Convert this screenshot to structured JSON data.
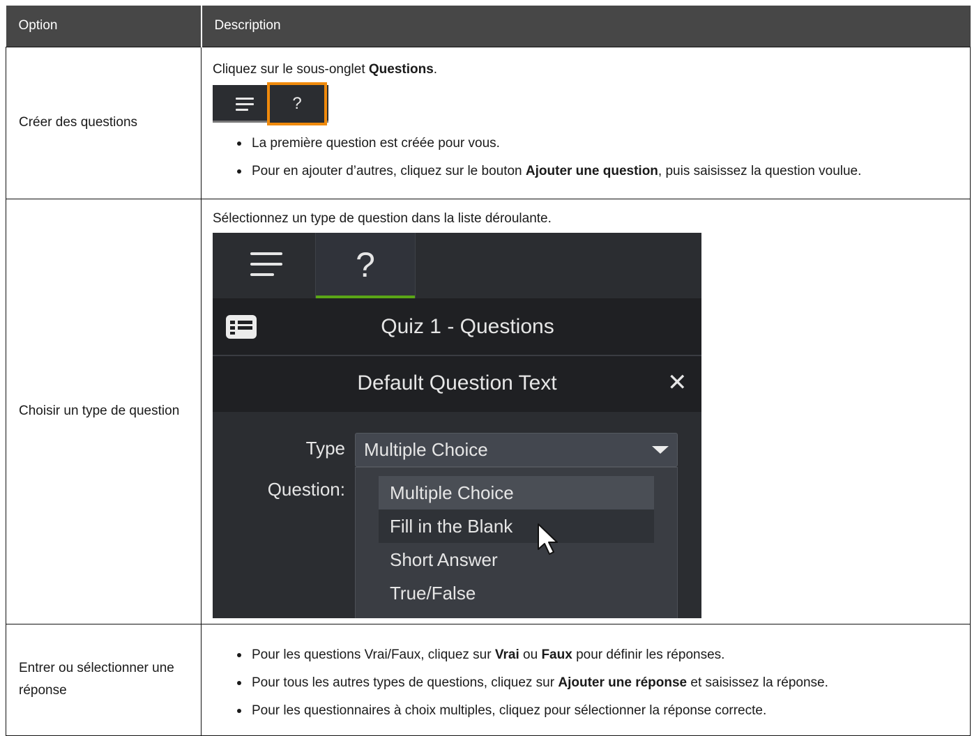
{
  "table": {
    "headers": {
      "option": "Option",
      "description": "Description"
    },
    "rows": [
      {
        "option": "Créer des questions",
        "intro_pre": "Cliquez sur le sous-onglet ",
        "intro_bold": "Questions",
        "intro_post": ".",
        "toolbar": {
          "tab_questions_glyph": "?",
          "highlight_color": "#f08a0c"
        },
        "bullets": [
          {
            "text": "La première question est créée pour vous."
          },
          {
            "pre": "Pour en ajouter d’autres, cliquez sur le bouton ",
            "bold": "Ajouter une question",
            "post": ", puis saisissez la question voulue."
          }
        ]
      },
      {
        "option": "Choisir un type de question",
        "intro": "Sélectionnez un type de question dans la liste déroulante.",
        "screenshot": {
          "tab_questions_glyph": "?",
          "quiz_title": "Quiz 1 - Questions",
          "question_title": "Default Question Text",
          "close_glyph": "✕",
          "type_label": "Type",
          "question_label": "Question:",
          "selected_type": "Multiple Choice",
          "options": [
            "Multiple Choice",
            "Fill in the Blank",
            "Short Answer",
            "True/False"
          ],
          "active_tab_indicator_color": "#5aa617"
        }
      },
      {
        "option": "Entrer ou sélectionner une réponse",
        "bullets": [
          {
            "pre": "Pour les questions Vrai/Faux, cliquez sur ",
            "bold": "Vrai",
            "mid": " ou ",
            "bold2": "Faux",
            "post": " pour définir les réponses."
          },
          {
            "pre": "Pour tous les autres types de questions, cliquez sur ",
            "bold": "Ajouter une réponse",
            "post": " et saisissez la réponse."
          },
          {
            "text": "Pour les questionnaires à choix multiples, cliquez pour sélectionner la réponse correcte."
          }
        ]
      }
    ]
  }
}
